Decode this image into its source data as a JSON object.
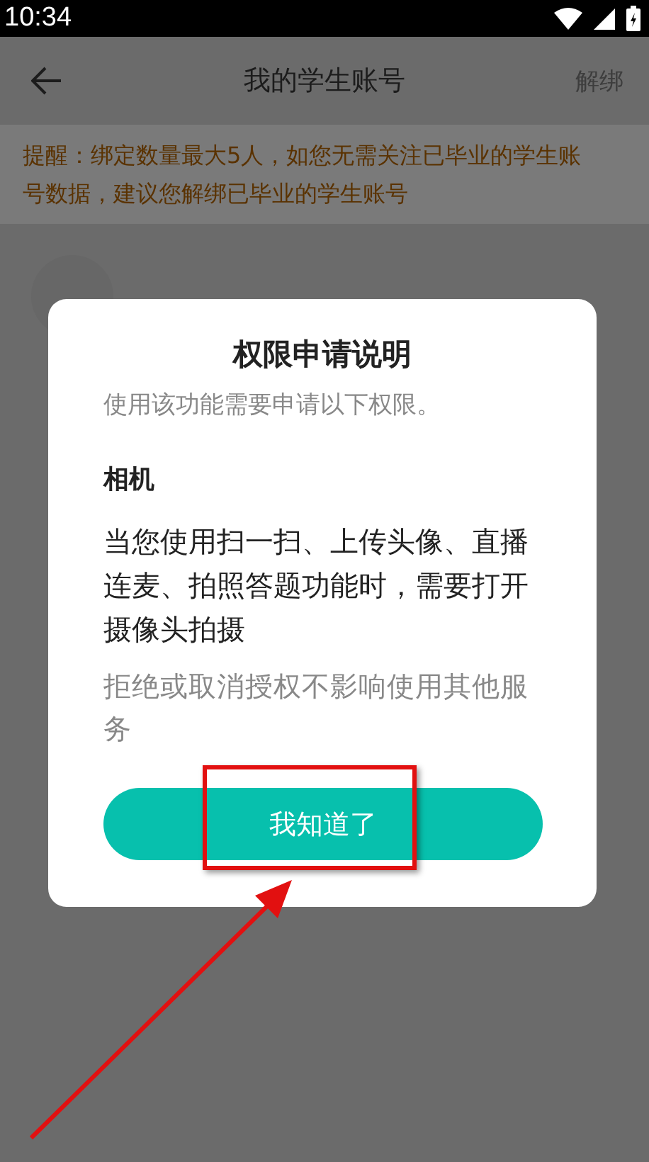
{
  "status_bar": {
    "time": "10:34"
  },
  "header": {
    "title": "我的学生账号",
    "action": "解绑"
  },
  "notice": "提醒：绑定数量最大5人，如您无需关注已毕业的学生账号数据，建议您解绑已毕业的学生账号",
  "dialog": {
    "title": "权限申请说明",
    "intro": "使用该功能需要申请以下权限。",
    "permission": "相机",
    "description": "当您使用扫一扫、上传头像、直播连麦、拍照答题功能时，需要打开摄像头拍摄",
    "footnote": "拒绝或取消授权不影响使用其他服务",
    "button": "我知道了"
  }
}
